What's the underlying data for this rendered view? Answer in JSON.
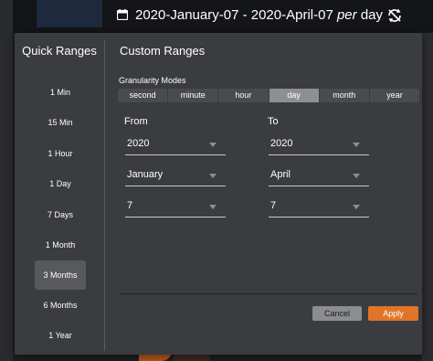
{
  "header": {
    "range_text": "2020-January-07 - 2020-April-07",
    "per_text": "per",
    "unit_text": "day",
    "calendar_icon": "calendar-icon",
    "sync_icon": "sync-off-icon"
  },
  "quick_ranges": {
    "title": "Quick Ranges",
    "items": [
      {
        "label": "1 Min"
      },
      {
        "label": "15 Min"
      },
      {
        "label": "1 Hour"
      },
      {
        "label": "1 Day"
      },
      {
        "label": "7 Days"
      },
      {
        "label": "1 Month"
      },
      {
        "label": "3 Months"
      },
      {
        "label": "6 Months"
      },
      {
        "label": "1 Year"
      }
    ],
    "selected": "3 Months"
  },
  "custom_ranges": {
    "title": "Custom Ranges",
    "granularity_label": "Granularity Modes",
    "granularity_options": [
      "second",
      "minute",
      "hour",
      "day",
      "month",
      "year"
    ],
    "granularity_selected": "day",
    "from": {
      "label": "From",
      "year": "2020",
      "month": "January",
      "day": "7"
    },
    "to": {
      "label": "To",
      "year": "2020",
      "month": "April",
      "day": "7"
    },
    "cancel_label": "Cancel",
    "apply_label": "Apply"
  },
  "colors": {
    "accent": "#e07428",
    "popup_bg": "#3b3c40",
    "active_granularity": "#8e8f92"
  }
}
